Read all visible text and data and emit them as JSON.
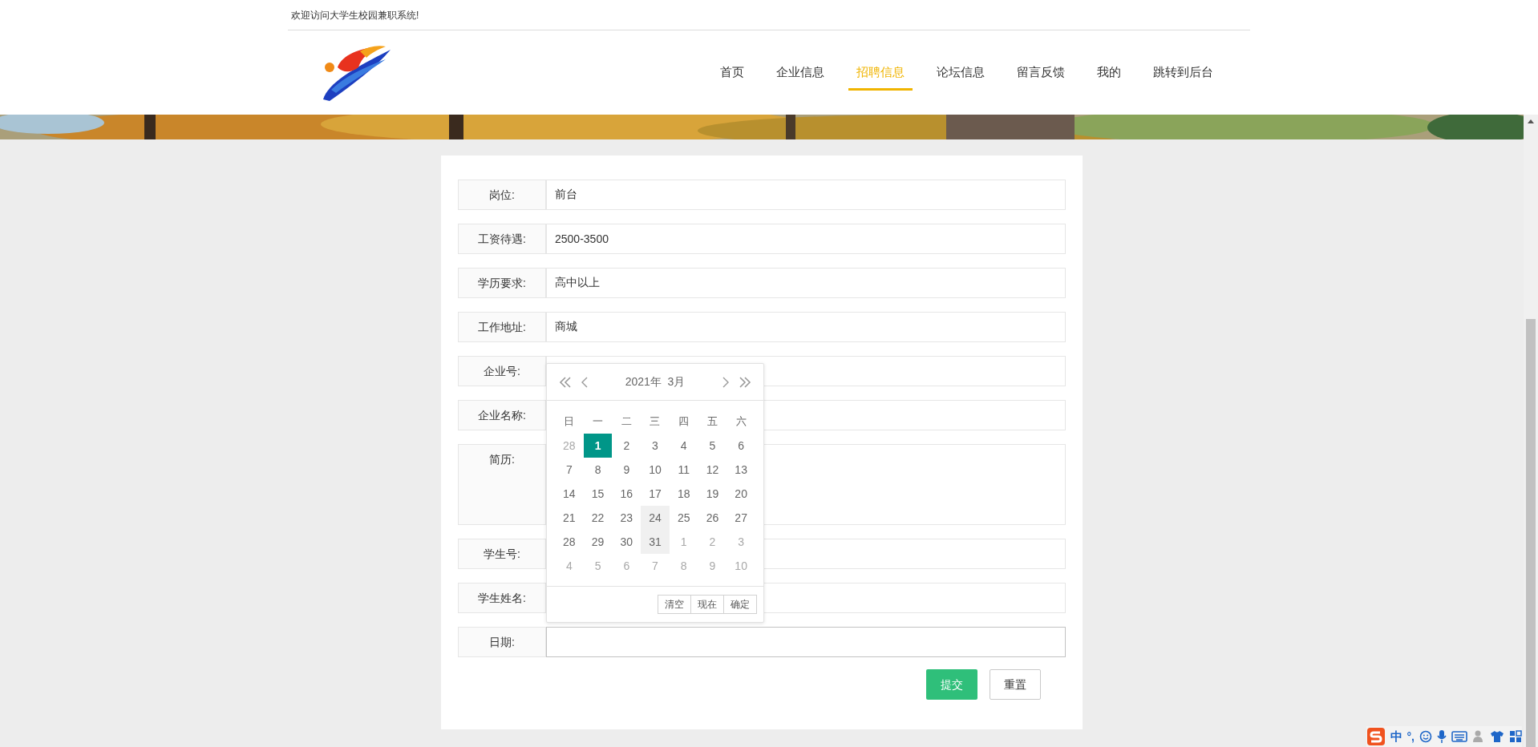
{
  "welcome": "欢迎访问大学生校园兼职系统!",
  "nav": [
    {
      "label": "首页",
      "selected": false
    },
    {
      "label": "企业信息",
      "selected": false
    },
    {
      "label": "招聘信息",
      "selected": true
    },
    {
      "label": "论坛信息",
      "selected": false
    },
    {
      "label": "留言反馈",
      "selected": false
    },
    {
      "label": "我的",
      "selected": false
    },
    {
      "label": "跳转到后台",
      "selected": false
    }
  ],
  "form": {
    "rows": [
      {
        "label": "岗位:",
        "value": "前台",
        "kind": "input",
        "focused": false
      },
      {
        "label": "工资待遇:",
        "value": "2500-3500",
        "kind": "input",
        "focused": false
      },
      {
        "label": "学历要求:",
        "value": "高中以上",
        "kind": "input",
        "focused": false
      },
      {
        "label": "工作地址:",
        "value": "商城",
        "kind": "input",
        "focused": false
      },
      {
        "label": "企业号:",
        "kind": "input",
        "focused": false
      },
      {
        "label": "企业名称:",
        "kind": "input",
        "focused": false
      },
      {
        "label": "简历:",
        "kind": "textarea",
        "focused": false
      },
      {
        "label": "学生号:",
        "kind": "input",
        "focused": false
      },
      {
        "label": "学生姓名:",
        "kind": "input",
        "focused": false
      },
      {
        "label": "日期:",
        "kind": "input",
        "focused": true
      }
    ],
    "buttons": [
      {
        "label": "提交",
        "kind": "primary"
      },
      {
        "label": "重置",
        "kind": "plain"
      }
    ]
  },
  "date_picker": {
    "title": "2021年  3月",
    "weekdays": [
      "日",
      "一",
      "二",
      "三",
      "四",
      "五",
      "六"
    ],
    "days": [
      {
        "label": "28",
        "muted": true,
        "selected": false,
        "hovered": false
      },
      {
        "label": "1",
        "muted": false,
        "selected": true,
        "hovered": false
      },
      {
        "label": "2",
        "muted": false,
        "selected": false,
        "hovered": false
      },
      {
        "label": "3",
        "muted": false,
        "selected": false,
        "hovered": false
      },
      {
        "label": "4",
        "muted": false,
        "selected": false,
        "hovered": false
      },
      {
        "label": "5",
        "muted": false,
        "selected": false,
        "hovered": false
      },
      {
        "label": "6",
        "muted": false,
        "selected": false,
        "hovered": false
      },
      {
        "label": "7",
        "muted": false,
        "selected": false,
        "hovered": false
      },
      {
        "label": "8",
        "muted": false,
        "selected": false,
        "hovered": false
      },
      {
        "label": "9",
        "muted": false,
        "selected": false,
        "hovered": false
      },
      {
        "label": "10",
        "muted": false,
        "selected": false,
        "hovered": false
      },
      {
        "label": "11",
        "muted": false,
        "selected": false,
        "hovered": false
      },
      {
        "label": "12",
        "muted": false,
        "selected": false,
        "hovered": false
      },
      {
        "label": "13",
        "muted": false,
        "selected": false,
        "hovered": false
      },
      {
        "label": "14",
        "muted": false,
        "selected": false,
        "hovered": false
      },
      {
        "label": "15",
        "muted": false,
        "selected": false,
        "hovered": false
      },
      {
        "label": "16",
        "muted": false,
        "selected": false,
        "hovered": false
      },
      {
        "label": "17",
        "muted": false,
        "selected": false,
        "hovered": false
      },
      {
        "label": "18",
        "muted": false,
        "selected": false,
        "hovered": false
      },
      {
        "label": "19",
        "muted": false,
        "selected": false,
        "hovered": false
      },
      {
        "label": "20",
        "muted": false,
        "selected": false,
        "hovered": false
      },
      {
        "label": "21",
        "muted": false,
        "selected": false,
        "hovered": false
      },
      {
        "label": "22",
        "muted": false,
        "selected": false,
        "hovered": false
      },
      {
        "label": "23",
        "muted": false,
        "selected": false,
        "hovered": false
      },
      {
        "label": "24",
        "muted": false,
        "selected": false,
        "hovered": true
      },
      {
        "label": "25",
        "muted": false,
        "selected": false,
        "hovered": false
      },
      {
        "label": "26",
        "muted": false,
        "selected": false,
        "hovered": false
      },
      {
        "label": "27",
        "muted": false,
        "selected": false,
        "hovered": false
      },
      {
        "label": "28",
        "muted": false,
        "selected": false,
        "hovered": false
      },
      {
        "label": "29",
        "muted": false,
        "selected": false,
        "hovered": false
      },
      {
        "label": "30",
        "muted": false,
        "selected": false,
        "hovered": false
      },
      {
        "label": "31",
        "muted": false,
        "selected": false,
        "hovered": true
      },
      {
        "label": "1",
        "muted": true,
        "selected": false,
        "hovered": false
      },
      {
        "label": "2",
        "muted": true,
        "selected": false,
        "hovered": false
      },
      {
        "label": "3",
        "muted": true,
        "selected": false,
        "hovered": false
      },
      {
        "label": "4",
        "muted": true,
        "selected": false,
        "hovered": false
      },
      {
        "label": "5",
        "muted": true,
        "selected": false,
        "hovered": false
      },
      {
        "label": "6",
        "muted": true,
        "selected": false,
        "hovered": false
      },
      {
        "label": "7",
        "muted": true,
        "selected": false,
        "hovered": false
      },
      {
        "label": "8",
        "muted": true,
        "selected": false,
        "hovered": false
      },
      {
        "label": "9",
        "muted": true,
        "selected": false,
        "hovered": false
      },
      {
        "label": "10",
        "muted": true,
        "selected": false,
        "hovered": false
      }
    ],
    "buttons": [
      "清空",
      "现在",
      "确定"
    ]
  },
  "ime_toolbar": {
    "mode": "中",
    "punctuation": "°,"
  }
}
